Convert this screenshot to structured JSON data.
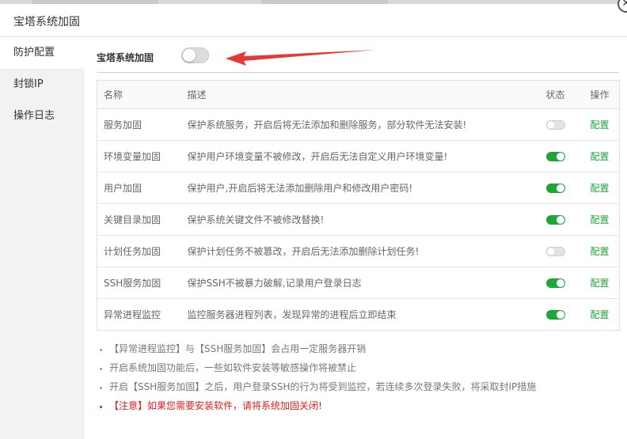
{
  "dialog": {
    "title": "宝塔系统加固",
    "close_glyph": "✕"
  },
  "sidebar": {
    "items": [
      {
        "label": "防护配置",
        "active": true
      },
      {
        "label": "封锁IP",
        "active": false
      },
      {
        "label": "操作日志",
        "active": false
      }
    ]
  },
  "main_toggle": {
    "label": "宝塔系统加固",
    "enabled": false
  },
  "annotation": {
    "arrow_color": "#e53935"
  },
  "table": {
    "headers": {
      "name": "名称",
      "desc": "描述",
      "status": "状态",
      "action": "操作"
    },
    "rows": [
      {
        "name": "服务加固",
        "desc": "保护系统服务，开启后将无法添加和删除服务，部分软件无法安装!",
        "enabled": false,
        "action": "配置"
      },
      {
        "name": "环境变量加固",
        "desc": "保护用户环境变量不被修改，开启后无法自定义用户环境变量!",
        "enabled": true,
        "action": "配置"
      },
      {
        "name": "用户加固",
        "desc": "保护用户,开启后将无法添加删除用户和修改用户密码!",
        "enabled": true,
        "action": "配置"
      },
      {
        "name": "关键目录加固",
        "desc": "保护系统关键文件不被修改替换!",
        "enabled": true,
        "action": "配置"
      },
      {
        "name": "计划任务加固",
        "desc": "保护计划任务不被篡改，开启后无法添加删除计划任务!",
        "enabled": false,
        "action": "配置"
      },
      {
        "name": "SSH服务加固",
        "desc": "保护SSH不被暴力破解,记录用户登录日志",
        "enabled": true,
        "action": "配置"
      },
      {
        "name": "异常进程监控",
        "desc": "监控服务器进程列表，发现异常的进程后立即结束",
        "enabled": true,
        "action": "配置"
      }
    ]
  },
  "notes": [
    {
      "text": "【异常进程监控】与【SSH服务加固】会占用一定服务器开销",
      "warn": false
    },
    {
      "text": "开启系统加固功能后，一些如软件安装等敏感操作将被禁止",
      "warn": false
    },
    {
      "text": "开启【SSH服务加固】之后，用户登录SSH的行为将受到监控，若连续多次登录失败，将采取封IP措施",
      "warn": false
    },
    {
      "text": "【注意】如果您需要安装软件，请将系统加固关闭!",
      "warn": true
    }
  ],
  "colors": {
    "accent": "#20a53a",
    "warning": "#e02020",
    "sidebar_bg": "#f2f2f2"
  }
}
